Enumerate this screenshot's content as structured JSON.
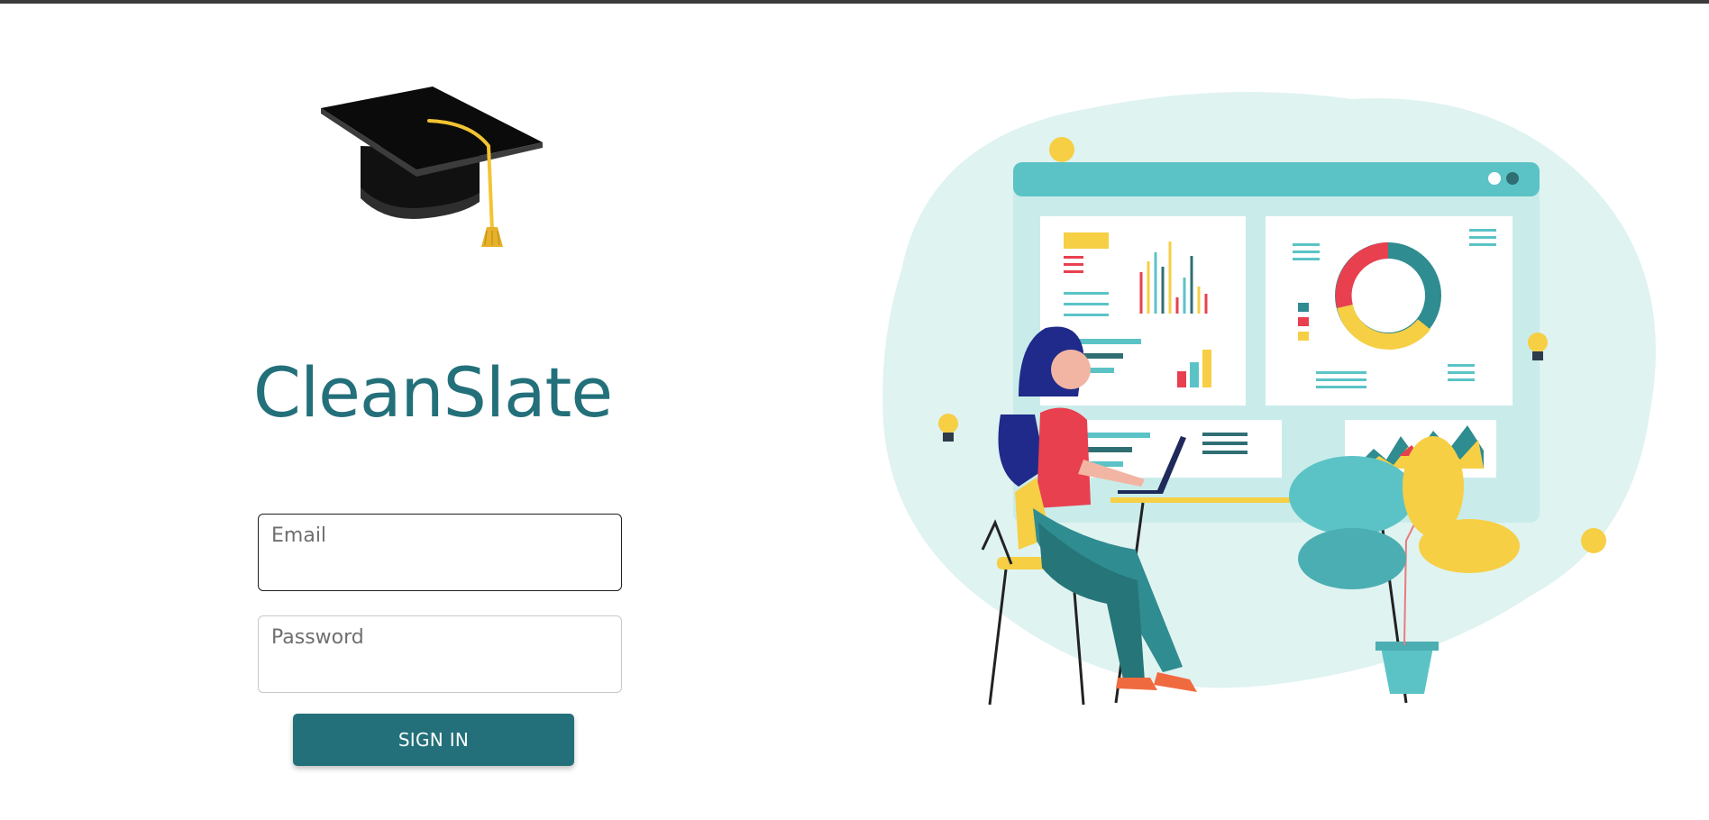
{
  "app": {
    "title": "CleanSlate"
  },
  "login": {
    "email_placeholder": "Email",
    "password_placeholder": "Password",
    "signin_label": "SIGN IN"
  },
  "colors": {
    "brand_teal": "#23707a",
    "illustration_teal": "#5bc3c6",
    "illustration_yellow": "#f6cf45",
    "illustration_red": "#e8404f"
  },
  "icons": {
    "logo": "graduation-cap-icon"
  }
}
